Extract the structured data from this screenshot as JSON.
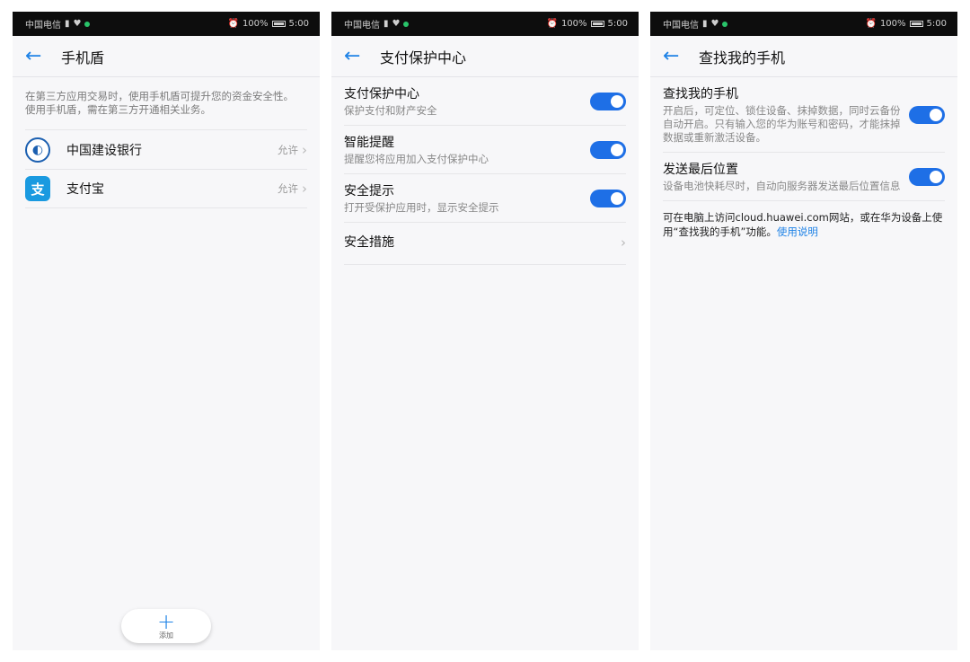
{
  "status_bar": {
    "carrier": "中国电信",
    "battery": "100%",
    "time": "5:00"
  },
  "screen1": {
    "title": "手机盾",
    "description_line1": "在第三方应用交易时，使用手机盾可提升您的资金安全性。",
    "description_line2": "使用手机盾，需在第三方开通相关业务。",
    "apps": [
      {
        "name": "中国建设银行",
        "status": "允许",
        "icon": "ccb-logo-icon"
      },
      {
        "name": "支付宝",
        "status": "允许",
        "icon": "alipay-logo-icon",
        "icon_glyph": "支"
      }
    ],
    "add_label": "添加"
  },
  "screen2": {
    "title": "支付保护中心",
    "settings": [
      {
        "title": "支付保护中心",
        "subtitle": "保护支付和财产安全",
        "enabled": true
      },
      {
        "title": "智能提醒",
        "subtitle": "提醒您将应用加入支付保护中心",
        "enabled": true
      },
      {
        "title": "安全提示",
        "subtitle": "打开受保护应用时，显示安全提示",
        "enabled": true
      }
    ],
    "nav_item": "安全措施"
  },
  "screen3": {
    "title": "查找我的手机",
    "settings": [
      {
        "title": "查找我的手机",
        "subtitle": "开启后，可定位、锁住设备、抹掉数据，同时云备份自动开启。只有输入您的华为账号和密码，才能抹掉数据或重新激活设备。",
        "enabled": true
      },
      {
        "title": "发送最后位置",
        "subtitle": "设备电池快耗尽时，自动向服务器发送最后位置信息",
        "enabled": true
      }
    ],
    "note_text": "可在电脑上访问cloud.huawei.com网站，或在华为设备上使用“查找我的手机”功能。",
    "note_link": "使用说明"
  },
  "colors": {
    "accent": "#1e82e6",
    "toggle_on": "#1e6fe6",
    "status_bar": "#0d0d0d"
  }
}
